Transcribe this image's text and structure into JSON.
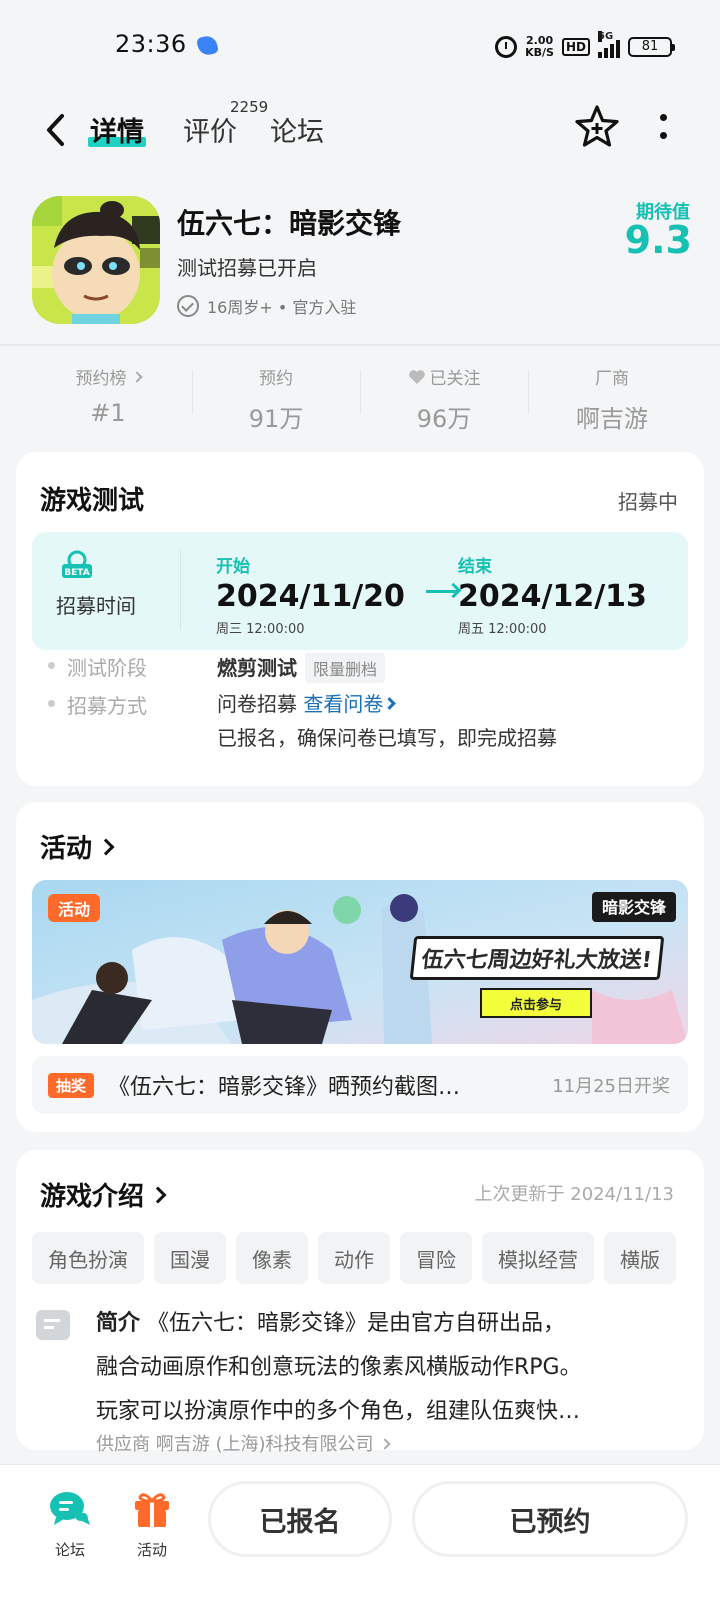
{
  "status_bar": {
    "time": "23:36",
    "speed_value": "2.00",
    "speed_unit": "KB/S",
    "hd": "HD",
    "network": "5G",
    "battery": "81"
  },
  "nav": {
    "tabs": [
      {
        "label": "详情"
      },
      {
        "label": "评价"
      },
      {
        "label": "论坛"
      }
    ],
    "review_count": "2259"
  },
  "app": {
    "title": "伍六七：暗影交锋",
    "subtitle": "测试招募已开启",
    "meta": "16周岁+ • 官方入驻",
    "expect_label": "期待值",
    "expect_value": "9.3"
  },
  "stats": [
    {
      "label": "预约榜",
      "value": "#1"
    },
    {
      "label": "预约",
      "value": "91万"
    },
    {
      "label": "已关注",
      "value": "96万"
    },
    {
      "label": "厂商",
      "value": "啊吉游"
    }
  ],
  "test": {
    "title": "游戏测试",
    "status": "招募中",
    "recruit_label": "招募时间",
    "beta_badge": "BETA",
    "start_label": "开始",
    "start_date": "2024/11/20",
    "start_sub": "周三  12:00:00",
    "end_label": "结束",
    "end_date": "2024/12/13",
    "end_sub": "周五  12:00:00",
    "stage_key": "测试阶段",
    "stage_value": "燃剪测试",
    "stage_tag": "限量删档",
    "method_key": "招募方式",
    "method_value": "问卷招募",
    "method_link": "查看问卷",
    "method_note": "已报名，确保问卷已填写，即完成招募"
  },
  "activity": {
    "title": "活动",
    "banner_tag": "活动",
    "banner_text": "伍六七周边好礼大放送!",
    "banner_btn": "点击参与",
    "banner_logo": "暗影交锋",
    "lottery_tag": "抽奖",
    "lottery_text": "《伍六七：暗影交锋》晒预约截图…",
    "lottery_date": "11月25日开奖"
  },
  "intro": {
    "title": "游戏介绍",
    "updated": "上次更新于 2024/11/13",
    "tags": [
      "角色扮演",
      "国漫",
      "像素",
      "动作",
      "冒险",
      "模拟经营",
      "横版"
    ],
    "lead": "简介",
    "line1": "《伍六七：暗影交锋》是由官方自研出品，",
    "line2": "融合动画原作和创意玩法的像素风横版动作RPG。",
    "line3": "玩家可以扮演原作中的多个角色，组建队伍爽快…",
    "supplier": "供应商 啊吉游 (上海)科技有限公司"
  },
  "bottom": {
    "forum": "论坛",
    "activity": "活动",
    "signed": "已报名",
    "reserved": "已预约"
  },
  "colors": {
    "accent": "#16c1b4",
    "orange": "#ff6a2a",
    "link": "#1a6fb8"
  },
  "icons": [
    "bubble-icon",
    "alarm-icon",
    "signal-icon",
    "battery-icon",
    "back-icon",
    "star-plus-icon",
    "more-icon",
    "check-icon",
    "chevron-right-icon",
    "heart-icon",
    "beta-icon",
    "arrow-right-icon",
    "note-icon",
    "forum-icon",
    "gift-icon"
  ]
}
